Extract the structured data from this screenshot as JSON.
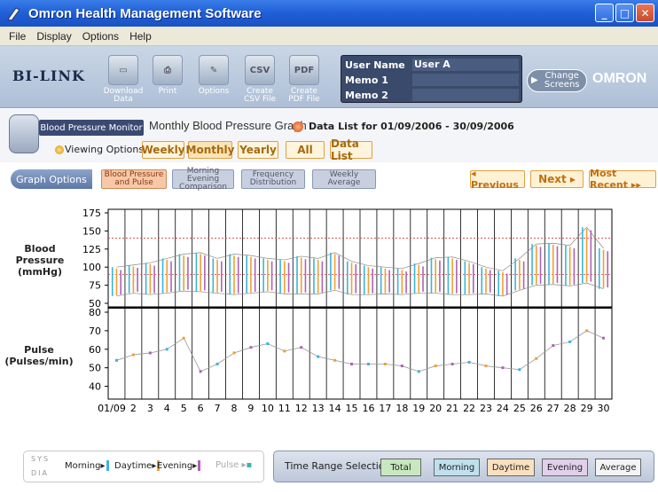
{
  "window": {
    "title": "Omron Health Management Software"
  },
  "menu": [
    "File",
    "Display",
    "Options",
    "Help"
  ],
  "toolbar": {
    "logo": "BI-LINK",
    "tools": [
      {
        "label": "Download Data",
        "icon": "download-icon"
      },
      {
        "label": "Print",
        "icon": "print-icon"
      },
      {
        "label": "Options",
        "icon": "options-icon"
      },
      {
        "label": "Create CSV File",
        "icon": "csv-icon",
        "glyph": "CSV"
      },
      {
        "label": "Create PDF File",
        "icon": "pdf-icon",
        "glyph": "PDF"
      }
    ],
    "user_name_label": "User Name",
    "user_name_value": "User A",
    "memo1_label": "Memo 1",
    "memo1_value": "",
    "memo2_label": "Memo 2",
    "memo2_value": "",
    "change_screens": "Change Screens",
    "brand": "OMRON"
  },
  "subheader": {
    "tab": "Blood Pressure Monitor",
    "graph_title": "Monthly Blood Pressure Graph",
    "data_list_range": "Data List for 01/09/2006 - 30/09/2006",
    "viewing_options_label": "Viewing Options",
    "viewing_buttons": [
      "Weekly",
      "Monthly",
      "Yearly",
      "All",
      "Data List"
    ],
    "active_view": "Monthly"
  },
  "graph_options": {
    "label": "Graph Options",
    "buttons": [
      "Blood Pressure and Pulse",
      "Morning Evening Comparison",
      "Frequency Distribution",
      "Weekly Average"
    ],
    "nav": [
      "◂ Previous",
      "Next ▸",
      "Most Recent ▸▸"
    ]
  },
  "chart_data": {
    "type": "line",
    "x": [
      "01/09",
      "2",
      "3",
      "4",
      "5",
      "6",
      "7",
      "8",
      "9",
      "10",
      "11",
      "12",
      "13",
      "14",
      "15",
      "16",
      "17",
      "18",
      "19",
      "20",
      "21",
      "22",
      "23",
      "24",
      "25",
      "26",
      "27",
      "28",
      "29",
      "30"
    ],
    "bp_label": "Blood Pressure (mmHg)",
    "bp_ylim": [
      50,
      175
    ],
    "bp_ticks": [
      50,
      75,
      100,
      125,
      150,
      175
    ],
    "bp_reference_lines": [
      140,
      90
    ],
    "systolic": [
      100,
      103,
      106,
      112,
      118,
      120,
      112,
      118,
      116,
      112,
      110,
      115,
      112,
      120,
      108,
      102,
      100,
      98,
      105,
      113,
      114,
      108,
      100,
      95,
      112,
      132,
      133,
      130,
      155,
      126
    ],
    "diastolic": [
      60,
      64,
      62,
      64,
      67,
      66,
      64,
      62,
      64,
      66,
      63,
      63,
      63,
      68,
      62,
      62,
      63,
      62,
      64,
      64,
      62,
      62,
      63,
      60,
      68,
      75,
      76,
      74,
      78,
      70
    ],
    "pulse_label": "Pulse (Pulses/min)",
    "pulse_ylim": [
      35,
      80
    ],
    "pulse_ticks": [
      40,
      50,
      60,
      70,
      80
    ],
    "pulse": [
      54,
      57,
      58,
      60,
      66,
      48,
      52,
      58,
      61,
      63,
      59,
      61,
      56,
      54,
      52,
      52,
      52,
      51,
      48,
      51,
      52,
      53,
      51,
      50,
      49,
      55,
      62,
      64,
      70,
      66
    ]
  },
  "legend": {
    "sys": "SYS",
    "dia": "DIA",
    "morning": "Morning",
    "daytime": "Daytime",
    "evening": "Evening",
    "pulse": "Pulse",
    "colors": {
      "morning": "#3cb4d8",
      "daytime": "#f0a030",
      "evening": "#b060b8"
    }
  },
  "time_range": {
    "label": "Time Range Selection",
    "buttons": [
      "Total",
      "Morning",
      "Daytime",
      "Evening",
      "Average"
    ]
  }
}
